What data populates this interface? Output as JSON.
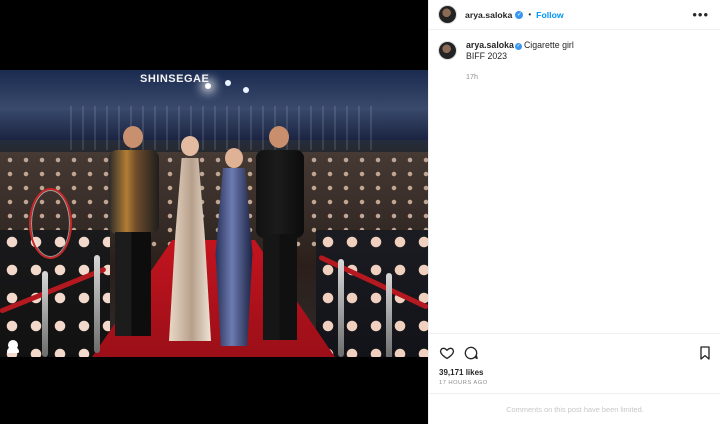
{
  "header": {
    "username": "arya.saloka",
    "follow_label": "Follow",
    "separator": "•",
    "more_label": "•••"
  },
  "photo": {
    "sign_text": "SHINSEGAE"
  },
  "caption": {
    "username": "arya.saloka",
    "line1": "Cigarette girl",
    "line2": "BIFF 2023",
    "time": "17h"
  },
  "icons": {
    "verified": "verified-icon",
    "like": "heart-icon",
    "comment": "comment-icon",
    "save": "bookmark-icon",
    "tagged_user": "user-icon"
  },
  "stats": {
    "likes": "39,171 likes",
    "posted_ago": "17 HOURS AGO"
  },
  "footer": {
    "comments_status": "Comments on this post have been limited."
  },
  "colors": {
    "accent": "#0095f6",
    "verified": "#3897f0",
    "highlight": "#c62828"
  }
}
